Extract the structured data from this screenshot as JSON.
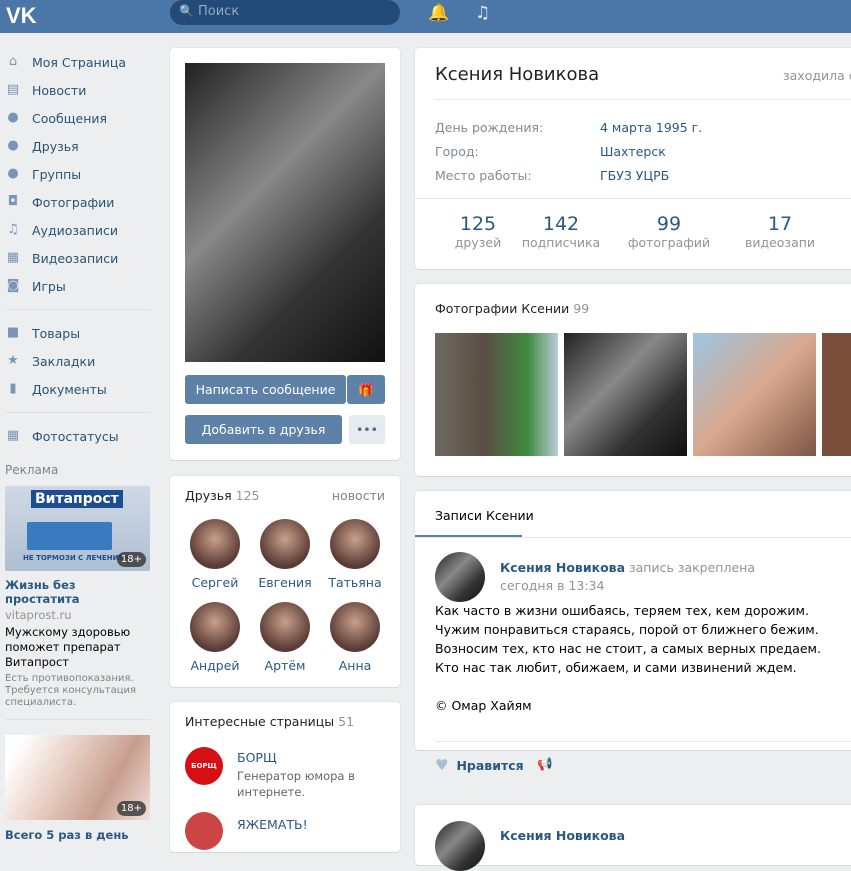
{
  "header": {
    "logo": "VK",
    "search_placeholder": "Поиск"
  },
  "nav": {
    "items": [
      {
        "label": "Моя Страница",
        "icon": "⌂"
      },
      {
        "label": "Новости",
        "icon": "▤"
      },
      {
        "label": "Сообщения",
        "icon": "●"
      },
      {
        "label": "Друзья",
        "icon": "●"
      },
      {
        "label": "Группы",
        "icon": "●"
      },
      {
        "label": "Фотографии",
        "icon": "◘"
      },
      {
        "label": "Аудиозаписи",
        "icon": "♫"
      },
      {
        "label": "Видеозаписи",
        "icon": "▦"
      },
      {
        "label": "Игры",
        "icon": "◙"
      }
    ],
    "items2": [
      {
        "label": "Товары",
        "icon": "■"
      },
      {
        "label": "Закладки",
        "icon": "★"
      },
      {
        "label": "Документы",
        "icon": "▮"
      }
    ],
    "items3": [
      {
        "label": "Фотостатусы",
        "icon": "▦"
      }
    ]
  },
  "ads": {
    "label": "Реклама",
    "ad1": {
      "image_text": "Витапрост",
      "slogan": "НЕ ТОРМОЗИ С ЛЕЧЕНИЕМ",
      "badge": "18+",
      "title": "Жизнь без простатита",
      "domain": "vitaprost.ru",
      "text": "Мужскому здоровью поможет препарат Витапрост",
      "note": "Есть противопоказания. Требуется консультация специалиста."
    },
    "ad2": {
      "badge": "18+",
      "title": "Всего 5 раз в день"
    }
  },
  "profile": {
    "send_message": "Написать сообщение",
    "add_friend": "Добавить в друзья",
    "more": "•••",
    "gift_icon": "gift"
  },
  "friends": {
    "title": "Друзья",
    "count": "125",
    "link": "новости",
    "items": [
      "Сергей",
      "Евгения",
      "Татьяна",
      "Андрей",
      "Артём",
      "Анна"
    ]
  },
  "pages": {
    "title": "Интересные страницы",
    "count": "51",
    "items": [
      {
        "name": "БОРЩ",
        "logo": "БОРЩ",
        "desc": "Генератор юмора в интернете."
      },
      {
        "name": "ЯЖЕМАТЬ!"
      }
    ]
  },
  "info": {
    "name": "Ксения Новикова",
    "last_seen": "заходила се",
    "rows": [
      {
        "label": "День рождения:",
        "value": "4 марта 1995 г."
      },
      {
        "label": "Город:",
        "value": "Шахтерск"
      },
      {
        "label": "Место работы:",
        "value": "ГБУЗ УЦРБ"
      }
    ],
    "stats": [
      {
        "n": "125",
        "l": "друзей"
      },
      {
        "n": "142",
        "l": "подписчика"
      },
      {
        "n": "99",
        "l": "фотографий"
      },
      {
        "n": "17",
        "l": "видеозапи"
      }
    ]
  },
  "photos": {
    "title": "Фотографии Ксении",
    "count": "99"
  },
  "wall": {
    "tab": "Записи Ксении",
    "post": {
      "author": "Ксения Новикова",
      "pinned": "запись закреплена",
      "time": "сегодня в 13:34",
      "lines": [
        "Как часто в жизни ошибаясь, теряем тех, кем дорожим.",
        "Чужим понравиться стараясь, порой от ближнего бежим.",
        "Возносим тех, кто нас не стоит, а самых верных предаем.",
        "Кто нас так любит, обижаем, и сами извинений ждем."
      ],
      "signature": "© Омар Хайям",
      "like": "Нравится"
    },
    "post2_author": "Ксения Новикова"
  }
}
